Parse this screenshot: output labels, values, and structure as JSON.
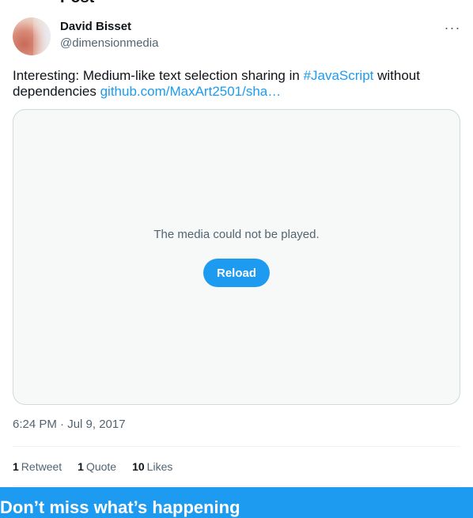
{
  "header": {
    "title": "Post"
  },
  "author": {
    "name": "David Bisset",
    "handle": "@dimensionmedia"
  },
  "more_menu": {
    "label": "···"
  },
  "tweet": {
    "text_before": "Interesting: Medium-like text selection sharing in ",
    "hashtag": "#JavaScript",
    "text_after": " without dependencies ",
    "link": "github.com/MaxArt2501/sha…"
  },
  "media": {
    "message": "The media could not be played.",
    "reload_label": "Reload"
  },
  "timestamp": "6:24 PM · Jul 9, 2017",
  "stats": [
    {
      "count": "1",
      "label": "Retweet"
    },
    {
      "count": "1",
      "label": "Quote"
    },
    {
      "count": "10",
      "label": "Likes"
    }
  ],
  "banner": {
    "title": "Don’t miss what’s happening"
  },
  "colors": {
    "accent": "#1d9bf0",
    "text": "#0f1419",
    "muted": "#536471",
    "border": "#cfd9de"
  }
}
